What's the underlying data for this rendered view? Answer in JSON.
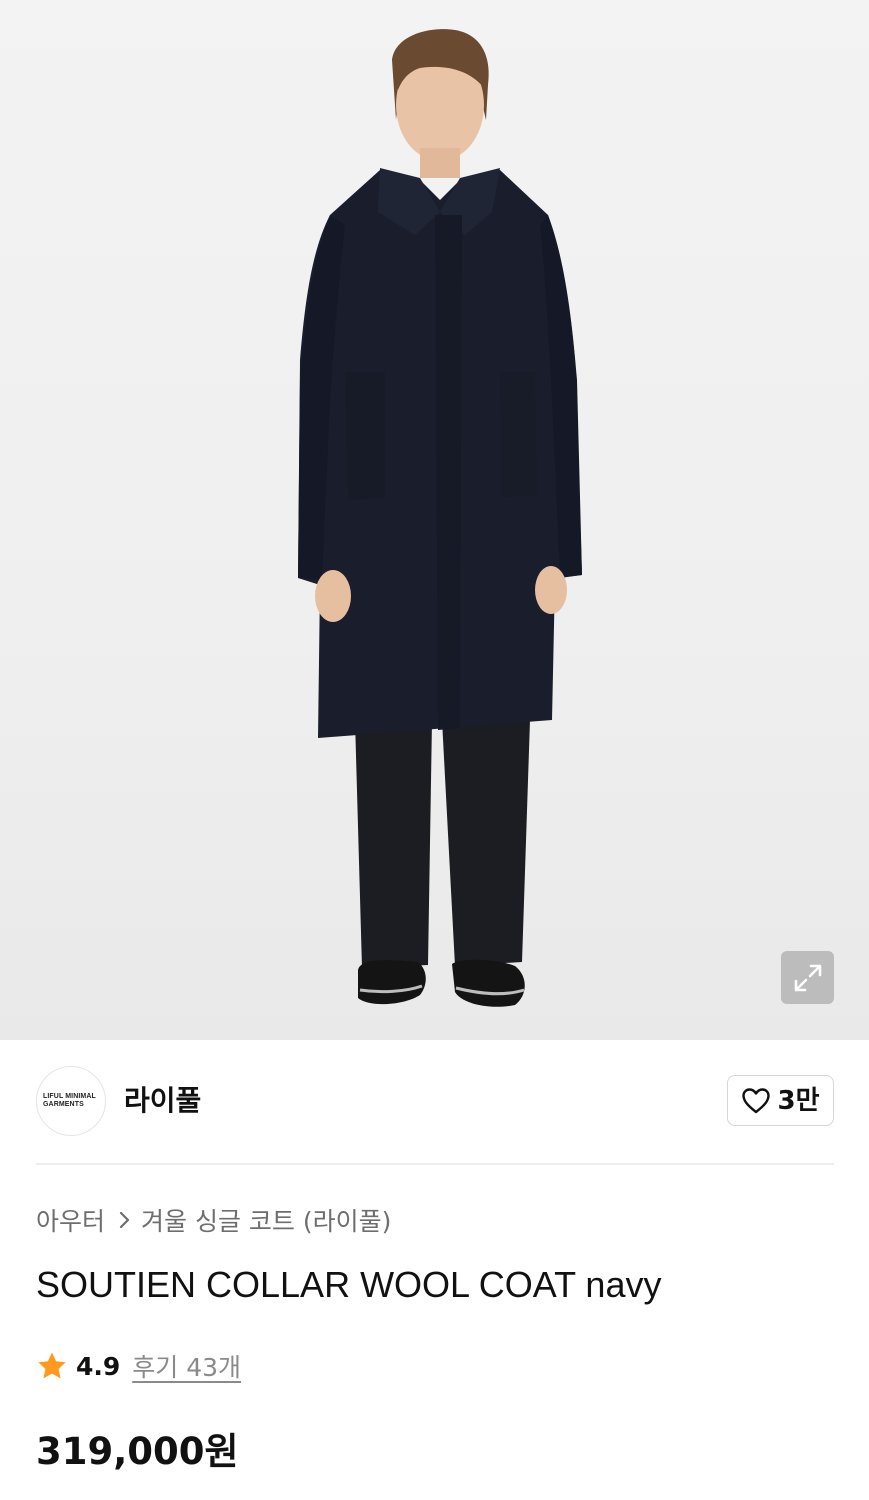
{
  "brand": {
    "logo_text": "LIFUL MINIMAL\nGARMENTS",
    "name": "라이풀",
    "like_count": "3만"
  },
  "breadcrumb": {
    "category": "아우터",
    "subcategory": "겨울 싱글 코트 (라이풀)"
  },
  "product": {
    "title": "SOUTIEN COLLAR WOOL COAT navy",
    "rating": "4.9",
    "review_label": "후기 43개",
    "price": "319,000원"
  },
  "icons": {
    "expand": "expand-icon",
    "like": "heart-outline-icon",
    "breadcrumb_separator": "chevron-right-icon",
    "rating": "star-icon"
  },
  "colors": {
    "star": "#FF9A1F",
    "text_primary": "#111111",
    "text_secondary": "#6E6E6E",
    "hero_background": "#F0F0F0"
  }
}
